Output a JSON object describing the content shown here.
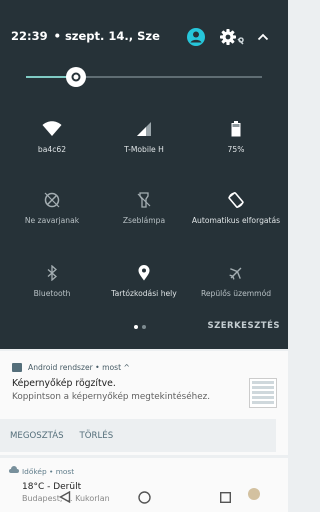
{
  "status": {
    "time": "22:39",
    "date": "• szept. 14., Sze"
  },
  "colors": {
    "panel": "#263238",
    "accent": "#26c6da",
    "brightness_track": "#80cbc4"
  },
  "brightness": {
    "level": 0.21
  },
  "tiles": [
    {
      "id": "wifi",
      "icon": "wifi-icon",
      "label": "ba4c62",
      "active": true
    },
    {
      "id": "cellular",
      "icon": "signal-icon",
      "label": "T-Mobile H",
      "active": true
    },
    {
      "id": "battery",
      "icon": "battery-icon",
      "label": "75%",
      "active": true
    },
    {
      "id": "dnd",
      "icon": "do-not-disturb-icon",
      "label": "Ne zavarjanak",
      "active": false
    },
    {
      "id": "flashlight",
      "icon": "flashlight-icon",
      "label": "Zseblámpa",
      "active": false
    },
    {
      "id": "rotate",
      "icon": "auto-rotate-icon",
      "label": "Automatikus elforgatás",
      "active": true
    },
    {
      "id": "bluetooth",
      "icon": "bluetooth-icon",
      "label": "Bluetooth",
      "active": false
    },
    {
      "id": "location",
      "icon": "location-icon",
      "label": "Tartózkodási hely",
      "active": true
    },
    {
      "id": "airplane",
      "icon": "airplane-icon",
      "label": "Repülős üzemmód",
      "active": false
    }
  ],
  "edit_label": "SZERKESZTÉS",
  "notification1": {
    "app": "Android rendszer • most ^",
    "title": "Képernyőkép rögzítve.",
    "body": "Koppintson a képernyőkép megtekintéséhez.",
    "actions": [
      "MEGOSZTÁS",
      "TÖRLÉS"
    ]
  },
  "notification2": {
    "app": "Időkép • most",
    "title": "18°C - Derült",
    "sub": "Budapest, ...  Kukorlan"
  }
}
